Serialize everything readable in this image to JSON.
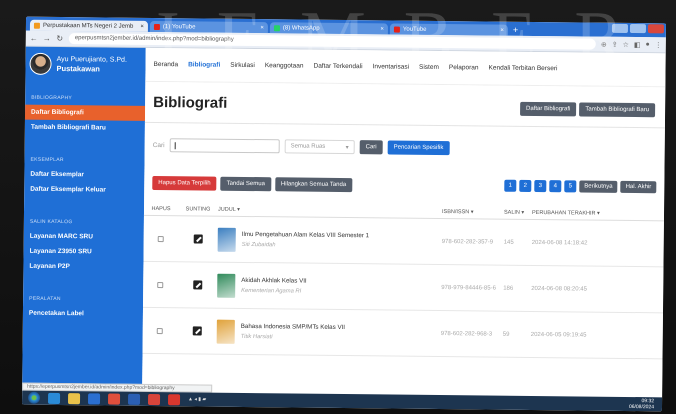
{
  "watermark": "JEMBER",
  "browser": {
    "tabs": [
      {
        "label": "Perpustakaan MTs Negeri 2 Jemb",
        "color": "#f29a1e",
        "active": true
      },
      {
        "label": "(1) YouTube",
        "color": "#e62117",
        "active": false
      },
      {
        "label": "(8) WhatsApp",
        "color": "#25d366",
        "active": false
      },
      {
        "label": "YouTube",
        "color": "#e62117",
        "active": false
      }
    ],
    "new_tab": "+",
    "url": "eperpusmtsn2jember.id/admin/index.php?mod=bibliography",
    "status_url": "https://eperpusmtsn2jember.id/admin/index.php?mod=bibliography"
  },
  "sidebar": {
    "user_name": "Ayu Puerujianto, S.Pd.",
    "user_role": "Pustakawan",
    "sections": [
      {
        "title": "BIBLIOGRAPHY",
        "items": [
          {
            "label": "Daftar Bibliografi",
            "active": true
          },
          {
            "label": "Tambah Bibliografi Baru",
            "active": false
          }
        ]
      },
      {
        "title": "EKSEMPLAR",
        "items": [
          {
            "label": "Daftar Eksemplar",
            "active": false
          },
          {
            "label": "Daftar Eksemplar Keluar",
            "active": false
          }
        ]
      },
      {
        "title": "SALIN KATALOG",
        "items": [
          {
            "label": "Layanan MARC SRU",
            "active": false
          },
          {
            "label": "Layanan Z3950 SRU",
            "active": false
          },
          {
            "label": "Layanan P2P",
            "active": false
          }
        ]
      },
      {
        "title": "PERALATAN",
        "items": [
          {
            "label": "Pencetakan Label",
            "active": false
          }
        ]
      }
    ]
  },
  "topnav": {
    "items": [
      {
        "label": "Beranda",
        "active": false
      },
      {
        "label": "Bibliografi",
        "active": true
      },
      {
        "label": "Sirkulasi",
        "active": false
      },
      {
        "label": "Keanggotaan",
        "active": false
      },
      {
        "label": "Daftar Terkendali",
        "active": false
      },
      {
        "label": "Inventarisasi",
        "active": false
      },
      {
        "label": "Sistem",
        "active": false
      },
      {
        "label": "Pelaporan",
        "active": false
      },
      {
        "label": "Kendali Terbitan Berseri",
        "active": false
      }
    ]
  },
  "main": {
    "title": "Bibliografi",
    "header_buttons": [
      "Daftar Bibliografi",
      "Tambah Bibliografi Baru"
    ],
    "search": {
      "label": "Cari",
      "placeholder": "",
      "field_select": "Semua Ruas",
      "search_button": "Cari",
      "advanced_button": "Pencarian Spesifik"
    },
    "actions": {
      "delete_selected": "Hapus Data Terpilih",
      "select_all": "Tandai Semua",
      "clear_all": "Hilangkan Semua Tanda"
    },
    "pager": {
      "pages": [
        "1",
        "2",
        "3",
        "4",
        "5"
      ],
      "next": "Berikutnya",
      "last": "Hal. Akhir"
    },
    "table": {
      "columns": [
        "HAPUS",
        "SUNTING",
        "JUDUL ▾",
        "ISBN/ISSN ▾",
        "SALIN ▾",
        "PERUBAHAN TERAKHIR ▾"
      ],
      "rows": [
        {
          "title": "Ilmu Pengetahuan Alam Kelas VIII Semester 1",
          "author": "Siti Zubaidah",
          "isbn": "978-602-282-357-9",
          "copies": "145",
          "updated": "2024-06-08 14:18:42",
          "cover": "#3b7fc0"
        },
        {
          "title": "Akidah Akhlak Kelas VII",
          "author": "Kementerian Agama RI",
          "isbn": "978-979-84446-85-6",
          "copies": "186",
          "updated": "2024-06-08 08:20:45",
          "cover": "#2f8a5a"
        },
        {
          "title": "Bahasa Indonesia SMP/MTs Kelas VII",
          "author": "Titik Harsiati",
          "isbn": "978-602-282-968-3",
          "copies": "59",
          "updated": "2024-06-05 09:19:45",
          "cover": "#e0a23a"
        }
      ]
    }
  },
  "taskbar": {
    "apps": [
      {
        "name": "ie-icon",
        "color": "#2a8ad6"
      },
      {
        "name": "folder-icon",
        "color": "#e9c24a"
      },
      {
        "name": "media-icon",
        "color": "#2b6fd0"
      },
      {
        "name": "chrome-icon",
        "color": "#e04f3c"
      },
      {
        "name": "word-icon",
        "color": "#2b5fb3"
      },
      {
        "name": "wps-icon",
        "color": "#d8443a"
      },
      {
        "name": "opera-icon",
        "color": "#d9372e"
      }
    ],
    "time": "09:32",
    "date": "06/08/2024"
  }
}
